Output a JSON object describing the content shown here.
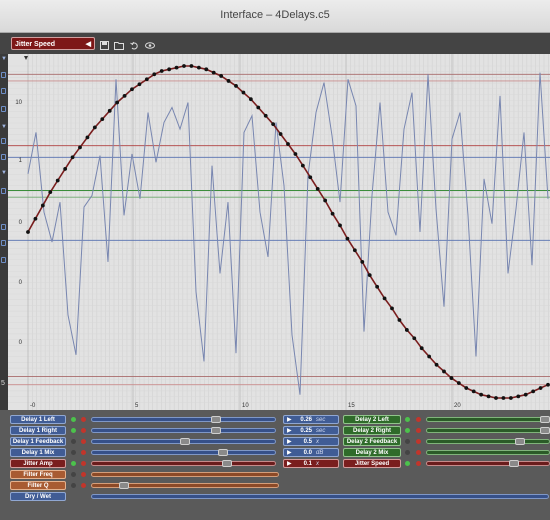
{
  "window": {
    "title": "Interface – 4Delays.c5"
  },
  "toolbar": {
    "preset_label": "Jitter Speed",
    "preset_arrow": "◀",
    "icons": [
      "save-icon",
      "folder-icon",
      "undo-icon",
      "eye-icon"
    ]
  },
  "plot": {
    "y_tick_labels": [
      "10",
      "1",
      "0",
      "0",
      "0"
    ],
    "x_tick_labels": [
      "-0",
      "5",
      "10",
      "15",
      "20"
    ],
    "colors": {
      "background": "#e2e2e2",
      "sine": "#7a1e1e",
      "jitter": "#7886b0",
      "grid": "#c9c9c9"
    }
  },
  "chart_data": {
    "type": "line",
    "x_axis_labels": [
      "-0",
      "5",
      "10",
      "15",
      "20"
    ],
    "y_axis_labels": [
      "10",
      "1",
      "0",
      "0",
      "0"
    ],
    "series": [
      {
        "kind": "sine",
        "color": "#7a1e1e",
        "values": [
          0.0,
          0.08,
          0.16,
          0.24,
          0.31,
          0.38,
          0.45,
          0.51,
          0.57,
          0.63,
          0.68,
          0.73,
          0.78,
          0.82,
          0.86,
          0.89,
          0.92,
          0.95,
          0.97,
          0.98,
          0.99,
          1.0,
          1.0,
          0.99,
          0.98,
          0.96,
          0.94,
          0.91,
          0.88,
          0.84,
          0.8,
          0.75,
          0.7,
          0.65,
          0.59,
          0.53,
          0.47,
          0.4,
          0.33,
          0.26,
          0.19,
          0.11,
          0.04,
          -0.04,
          -0.11,
          -0.18,
          -0.26,
          -0.33,
          -0.4,
          -0.46,
          -0.53,
          -0.59,
          -0.64,
          -0.7,
          -0.75,
          -0.8,
          -0.84,
          -0.88,
          -0.91,
          -0.94,
          -0.96,
          -0.98,
          -0.99,
          -1.0,
          -1.0,
          -1.0,
          -0.99,
          -0.98,
          -0.96,
          -0.94,
          -0.92
        ]
      },
      {
        "kind": "jitter",
        "color": "#7886b0",
        "values": [
          0.35,
          0.6,
          0.12,
          -0.06,
          0.18,
          -0.5,
          -0.74,
          0.15,
          0.22,
          0.46,
          -0.18,
          0.92,
          0.1,
          0.47,
          0.2,
          0.72,
          0.42,
          0.66,
          0.75,
          0.62,
          0.78,
          -0.36,
          -0.78,
          0.4,
          -0.25,
          0.18,
          -0.73,
          0.6,
          0.7,
          0.12,
          -0.15,
          0.66,
          0.28,
          -0.62,
          -0.98,
          0.34,
          0.72,
          0.9,
          0.58,
          0.18,
          0.92,
          0.76,
          -0.6,
          0.22,
          0.78,
          0.12,
          -0.02,
          0.62,
          0.84,
          0.0,
          0.95,
          0.14,
          -0.45,
          0.56,
          0.72,
          0.1,
          -0.75,
          0.32,
          0.05,
          0.82,
          -0.25,
          0.14,
          0.6,
          -0.2,
          0.96,
          0.2
        ]
      }
    ],
    "h_lines": [
      {
        "level": 0.95,
        "color": "#a86b6b"
      },
      {
        "level": 0.91,
        "color": "#c98d8d"
      },
      {
        "level": 0.52,
        "color": "#b04040"
      },
      {
        "level": 0.45,
        "color": "#5570b0"
      },
      {
        "level": 0.25,
        "color": "#3b8d3b"
      },
      {
        "level": 0.21,
        "color": "#6fa86f"
      },
      {
        "level": -0.05,
        "color": "#5570b0"
      },
      {
        "level": -0.87,
        "color": "#a86b6b"
      },
      {
        "level": -0.92,
        "color": "#c98d8d"
      }
    ]
  },
  "controls": {
    "left": [
      {
        "label": "Delay 1 Left",
        "color": "blue",
        "led": "g",
        "thumb": 0.68
      },
      {
        "label": "Delay 1 Right",
        "color": "blue",
        "led": "g",
        "thumb": 0.68
      },
      {
        "label": "Delay 1 Feedback",
        "color": "blue",
        "led": "d",
        "thumb": 0.5
      },
      {
        "label": "Delay 1 Mix",
        "color": "blue",
        "led": "d",
        "thumb": 0.72
      },
      {
        "label": "Jitter Amp",
        "color": "red",
        "led": "g",
        "thumb": 0.74
      },
      {
        "label": "Filter Freq",
        "color": "orange",
        "led": "d",
        "thumb": null
      },
      {
        "label": "Filter Q",
        "color": "orange",
        "led": "d",
        "thumb": 0.15
      },
      {
        "label": "Dry / Wet",
        "color": "blue",
        "led": "none",
        "thumb": null
      }
    ],
    "values": [
      {
        "value": "0.26",
        "unit": "sec",
        "color": "blue"
      },
      {
        "value": "0.25",
        "unit": "sec",
        "color": "blue"
      },
      {
        "value": "0.5",
        "unit": "x",
        "color": "blue"
      },
      {
        "value": "0.0",
        "unit": "dB",
        "color": "blue"
      },
      {
        "value": "0.1",
        "unit": "x",
        "color": "red"
      }
    ],
    "right": [
      {
        "label": "Delay 2 Left",
        "color": "green",
        "led": "g",
        "thumb": 0.95
      },
      {
        "label": "Delay 2 Right",
        "color": "green",
        "led": "g",
        "thumb": 0.95
      },
      {
        "label": "Delay 2 Feedback",
        "color": "green",
        "led": "d",
        "thumb": 0.75
      },
      {
        "label": "Delay 2 Mix",
        "color": "green",
        "led": "d",
        "thumb": null
      },
      {
        "label": "Jitter Speed",
        "color": "red",
        "led": "g",
        "thumb": 0.7
      }
    ]
  }
}
